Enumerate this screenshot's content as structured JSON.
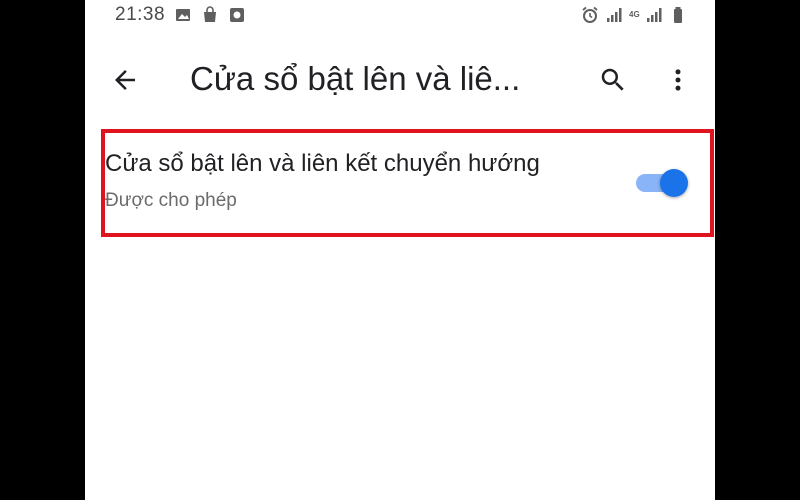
{
  "status_bar": {
    "time": "21:38",
    "left_icons": [
      "image-icon",
      "bag-icon",
      "square-notification-icon"
    ],
    "right_icons": [
      "alarm-icon",
      "signal-icon",
      "4g-network-icon",
      "signal-icon-2",
      "battery-icon"
    ],
    "network_label": "4G"
  },
  "toolbar": {
    "title": "Cửa sổ bật lên và liê...",
    "back_icon": "arrow-left-icon",
    "search_icon": "search-icon",
    "more_icon": "more-vert-icon"
  },
  "setting": {
    "title": "Cửa sổ bật lên và liên kết chuyển hướng",
    "subtitle": "Được cho phép",
    "enabled": true
  },
  "colors": {
    "highlight": "#e0141e",
    "accent": "#1a73e8",
    "track": "#8ab4f8"
  }
}
